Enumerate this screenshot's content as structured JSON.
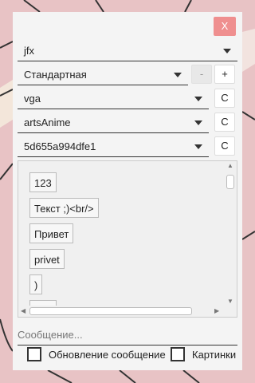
{
  "window": {
    "close_label": "X"
  },
  "selects": [
    {
      "value": "jfx"
    },
    {
      "value": "Стандартная"
    },
    {
      "value": "vga"
    },
    {
      "value": "artsAnime"
    },
    {
      "value": "5d655a994dfe1"
    }
  ],
  "buttons": {
    "minus": "-",
    "plus": "+",
    "c1": "C",
    "c2": "C",
    "c3": "C"
  },
  "messages": [
    "123",
    "Текст ;)<br/>",
    "Привет",
    "privet",
    ")",
    ""
  ],
  "composer": {
    "placeholder": "Сообщение..."
  },
  "options": {
    "refresh_label": "Обновление сообщение",
    "images_label": "Картинки"
  },
  "colors": {
    "close_button": "#ef8f8f",
    "background": "#e9c4c6",
    "panel": "#f4f4f4"
  }
}
